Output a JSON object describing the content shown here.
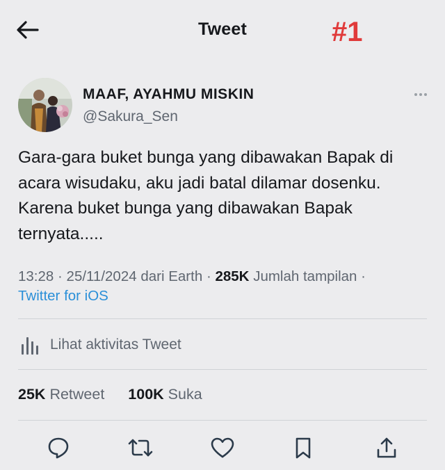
{
  "header": {
    "title": "Tweet",
    "rank_tag": "#1"
  },
  "author": {
    "display_name": "MAAF, AYAHMU MISKIN",
    "handle": "@Sakura_Sen"
  },
  "tweet": {
    "lines": [
      "Gara-gara buket bunga yang dibawakan Bapak di",
      "acara wisudaku, aku jadi batal dilamar dosenku.",
      "Karena buket bunga yang dibawakan Bapak",
      "ternyata....."
    ]
  },
  "meta": {
    "time": "13:28",
    "date": "25/11/2024",
    "location_text": "dari Earth",
    "views_count": "285K",
    "views_label": "Jumlah tampilan",
    "source": "Twitter for iOS"
  },
  "activity": {
    "label": "Lihat aktivitas Tweet"
  },
  "stats": {
    "retweets_count": "25K",
    "retweets_label": "Retweet",
    "likes_count": "100K",
    "likes_label": "Suka"
  },
  "colors": {
    "background": "#ececee",
    "rank_tag": "#e03a3a",
    "link": "#2a8fd8",
    "secondary_text": "#5f6670",
    "icon": "#2b3a4a"
  },
  "icons": {
    "back": "arrow-left-icon",
    "more": "more-dots-icon",
    "activity": "bar-chart-icon",
    "reply": "reply-bubble-icon",
    "retweet": "retweet-icon",
    "like": "heart-icon",
    "bookmark": "bookmark-icon",
    "share": "share-icon"
  }
}
